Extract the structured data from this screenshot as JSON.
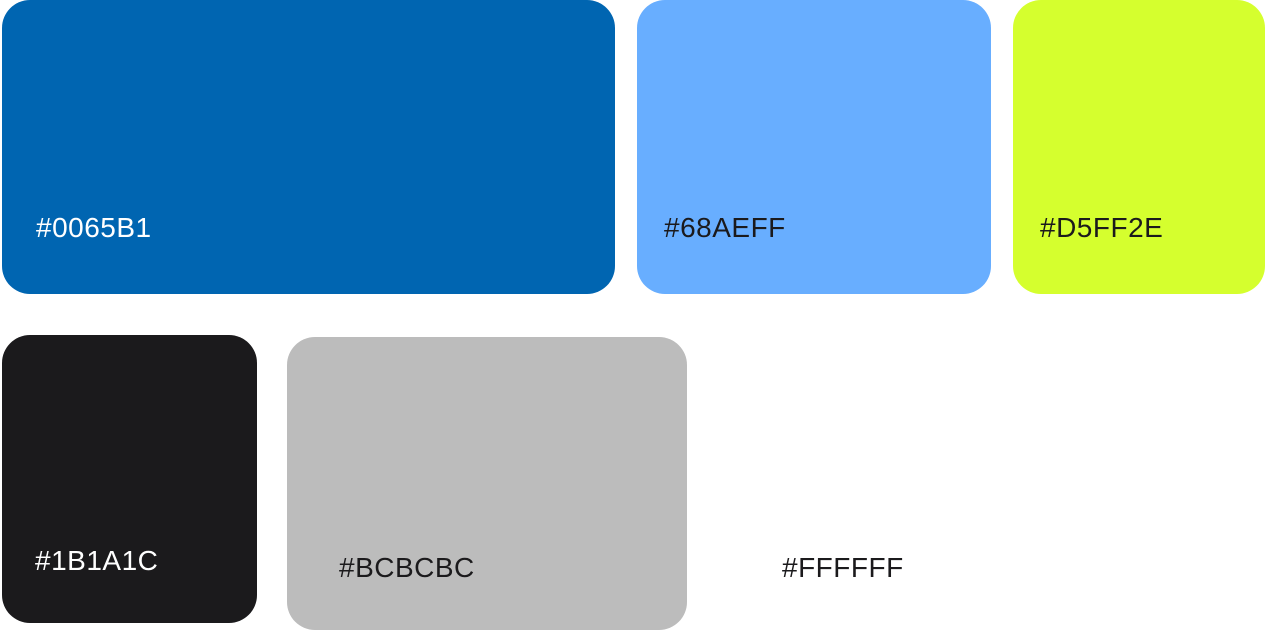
{
  "palette": {
    "swatches": [
      {
        "label": "#0065B1",
        "color": "#0065B1",
        "text_color": "#FFFFFF"
      },
      {
        "label": "#68AEFF",
        "color": "#68AEFF",
        "text_color": "#1B1A1C"
      },
      {
        "label": "#D5FF2E",
        "color": "#D5FF2E",
        "text_color": "#1B1A1C"
      },
      {
        "label": "#1B1A1C",
        "color": "#1B1A1C",
        "text_color": "#FFFFFF"
      },
      {
        "label": "#BCBCBC",
        "color": "#BCBCBC",
        "text_color": "#1B1A1C"
      },
      {
        "label": "#FFFFFF",
        "color": "#FFFFFF",
        "text_color": "#1B1A1C"
      }
    ]
  }
}
